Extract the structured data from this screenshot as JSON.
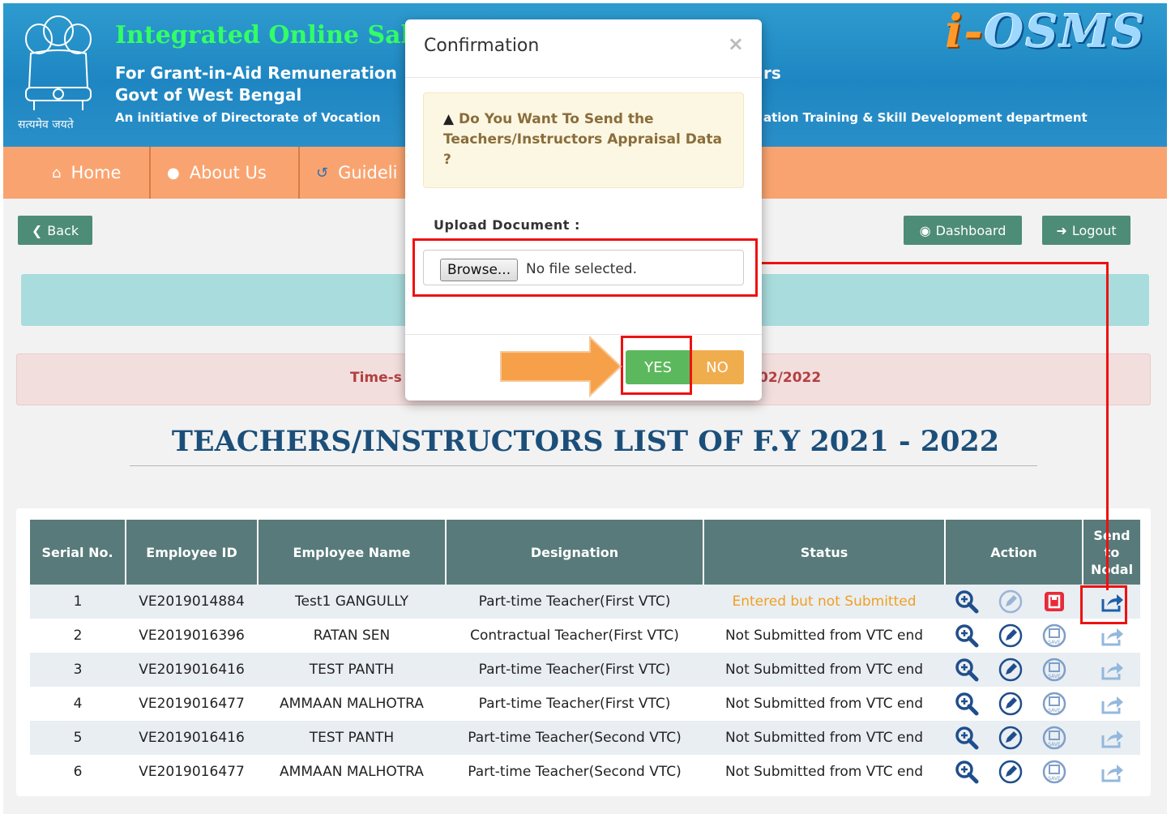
{
  "header": {
    "title": "Integrated Online Sal",
    "subtitle_1": "For Grant-in-Aid Remuneration",
    "subtitle_1_tail": "rs",
    "subtitle_2": "Govt of West Bengal",
    "subtitle_3": "An initiative of Directorate of Vocation",
    "subtitle_3_tail": "ation Training & Skill Development department",
    "motto": "सत्यमेव जयते",
    "logo_prefix": "i-",
    "logo_main": "OSMS"
  },
  "nav": {
    "items": [
      {
        "label": "Home",
        "icon": "home-icon"
      },
      {
        "label": "About Us",
        "icon": "info-icon"
      },
      {
        "label": "Guideli",
        "icon": "history-icon"
      }
    ]
  },
  "toolbar": {
    "back_label": "Back",
    "dashboard_label": "Dashboard",
    "logout_label": "Logout"
  },
  "alert": {
    "left_text": "Time-s",
    "right_text": "02/2022"
  },
  "list_title": "TEACHERS/INSTRUCTORS LIST OF F.Y 2021 - 2022",
  "table": {
    "headers": [
      "Serial No.",
      "Employee ID",
      "Employee Name",
      "Designation",
      "Status",
      "Action",
      "Send to Nodal"
    ],
    "send_header_lines": [
      "Send",
      "to",
      "Nodal"
    ],
    "rows": [
      {
        "serial": "1",
        "emp_id": "VE2019014884",
        "name": "Test1 GANGULLY",
        "designation": "Part-time Teacher(First VTC)",
        "status": "Entered but not Submitted"
      },
      {
        "serial": "2",
        "emp_id": "VE2019016396",
        "name": "RATAN SEN",
        "designation": "Contractual Teacher(First VTC)",
        "status": "Not Submitted from VTC end"
      },
      {
        "serial": "3",
        "emp_id": "VE2019016416",
        "name": "TEST PANTH",
        "designation": "Part-time Teacher(First VTC)",
        "status": "Not Submitted from VTC end"
      },
      {
        "serial": "4",
        "emp_id": "VE2019016477",
        "name": "AMMAAN MALHOTRA",
        "designation": "Part-time Teacher(First VTC)",
        "status": "Not Submitted from VTC end"
      },
      {
        "serial": "5",
        "emp_id": "VE2019016416",
        "name": "TEST PANTH",
        "designation": "Part-time Teacher(Second VTC)",
        "status": "Not Submitted from VTC end"
      },
      {
        "serial": "6",
        "emp_id": "VE2019016477",
        "name": "AMMAAN MALHOTRA",
        "designation": "Part-time Teacher(Second VTC)",
        "status": "Not Submitted from VTC end"
      }
    ]
  },
  "modal": {
    "title": "Confirmation",
    "close": "×",
    "warning": "Do You Want To Send the Teachers/Instructors Appraisal Data ?",
    "upload_label": "Upload Document :",
    "browse_label": "Browse...",
    "file_status": "No file selected.",
    "yes_label": "YES",
    "no_label": "NO"
  },
  "colors": {
    "header_blue": "#2e9bcf",
    "title_green": "#33ff66",
    "nav_orange": "#f9a470",
    "table_header": "#587a7a",
    "yes_green": "#5cb85c",
    "no_orange": "#f0ad4e",
    "annotation_red": "#ee1111",
    "arrow_orange": "#f7a04a",
    "status_orange": "#f0a020"
  }
}
